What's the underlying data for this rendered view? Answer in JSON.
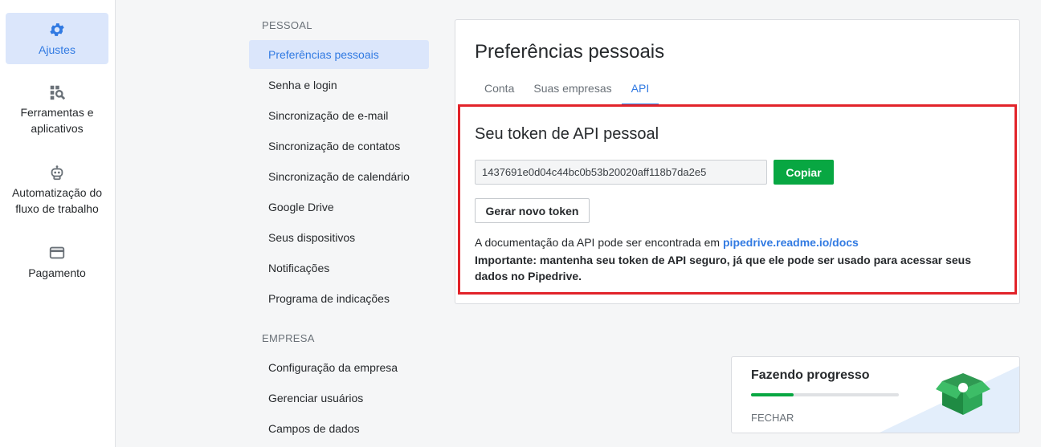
{
  "nav": {
    "items": [
      {
        "label": "Ajustes",
        "icon": "gear-icon",
        "active": true
      },
      {
        "label": "Ferramentas e aplicativos",
        "icon": "tools-icon",
        "active": false
      },
      {
        "label": "Automatização do fluxo de trabalho",
        "icon": "robot-icon",
        "active": false
      },
      {
        "label": "Pagamento",
        "icon": "credit-card-icon",
        "active": false
      }
    ]
  },
  "menu": {
    "pessoal_header": "PESSOAL",
    "pessoal_items": [
      "Preferências pessoais",
      "Senha e login",
      "Sincronização de e-mail",
      "Sincronização de contatos",
      "Sincronização de calendário",
      "Google Drive",
      "Seus dispositivos",
      "Notificações",
      "Programa de indicações"
    ],
    "active_item": "Preferências pessoais",
    "empresa_header": "EMPRESA",
    "empresa_items": [
      "Configuração da empresa",
      "Gerenciar usuários",
      "Campos de dados"
    ]
  },
  "panel": {
    "title": "Preferências pessoais",
    "tabs": [
      "Conta",
      "Suas empresas",
      "API"
    ],
    "active_tab": "API",
    "token_title": "Seu token de API pessoal",
    "token_value": "1437691e0d04c44bc0b53b20020aff118b7da2e5",
    "copy_label": "Copiar",
    "regen_label": "Gerar novo token",
    "doc_text": "A documentação da API pode ser encontrada em",
    "doc_link": "pipedrive.readme.io/docs",
    "important": "Importante: mantenha seu token de API seguro, já que ele pode ser usado para acessar seus dados no Pipedrive."
  },
  "progress": {
    "title": "Fazendo progresso",
    "fraction": 0.29,
    "close_label": "FECHAR"
  },
  "colors": {
    "accent": "#317ae2",
    "active_bg": "#dbe6fb",
    "success": "#08a742",
    "highlight": "#e2232a"
  }
}
